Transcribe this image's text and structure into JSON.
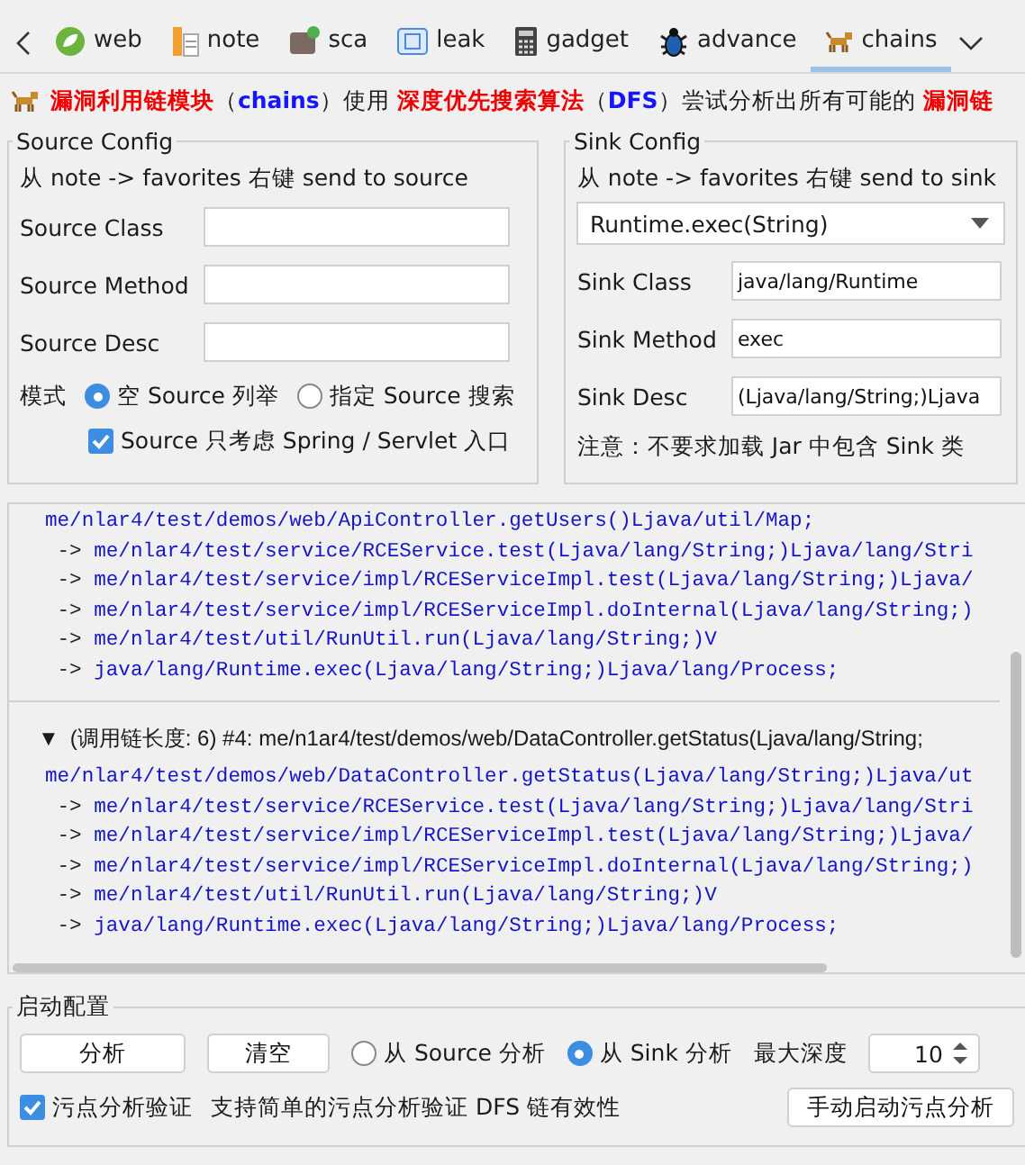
{
  "tabs": [
    {
      "label": "web",
      "selected": false
    },
    {
      "label": "note",
      "selected": false
    },
    {
      "label": "sca",
      "selected": false
    },
    {
      "label": "leak",
      "selected": false
    },
    {
      "label": "gadget",
      "selected": false
    },
    {
      "label": "advance",
      "selected": false
    },
    {
      "label": "chains",
      "selected": true
    }
  ],
  "banner": [
    {
      "text": "漏洞利用链模块",
      "kind": "red"
    },
    {
      "text": "（",
      "kind": "plain"
    },
    {
      "text": "chains",
      "kind": "blue"
    },
    {
      "text": "）使用 ",
      "kind": "plain"
    },
    {
      "text": "深度优先搜索算法",
      "kind": "red"
    },
    {
      "text": "（",
      "kind": "plain"
    },
    {
      "text": "DFS",
      "kind": "blue"
    },
    {
      "text": "）尝试分析出所有可能的 ",
      "kind": "plain"
    },
    {
      "text": "漏洞链",
      "kind": "red"
    }
  ],
  "source_config": {
    "title": "Source Config",
    "hint": "从 note -> favorites 右键 send to source",
    "fields": [
      {
        "label": "Source Class"
      },
      {
        "label": "Source Method"
      },
      {
        "label": "Source Desc"
      }
    ],
    "mode_label": "模式",
    "modes": [
      {
        "label": "空 Source 列举",
        "selected": true
      },
      {
        "label": "指定 Source 搜索",
        "selected": false
      }
    ],
    "entry_only": {
      "label": "Source 只考虑 Spring / Servlet 入口",
      "checked": true
    }
  },
  "sink_config": {
    "title": "Sink Config",
    "hint": "从 note -> favorites 右键 send to sink",
    "preset": "Runtime.exec(String)",
    "fields": [
      {
        "label": "Sink Class",
        "value": "java/lang/Runtime"
      },
      {
        "label": "Sink Method",
        "value": "exec"
      },
      {
        "label": "Sink Desc",
        "value": "(Ljava/lang/String;)Ljava"
      }
    ],
    "note": "注意：不要求加载 Jar 中包含 Sink 类"
  },
  "results": [
    {
      "lines": [
        {
          "call": "me/nlar4/test/demos/web/ApiController.getUsers()Ljava/util/Map;"
        },
        {
          "prefix": "->",
          "call": "me/nlar4/test/service/RCEService.test(Ljava/lang/String;)Ljava/lang/Stri"
        },
        {
          "prefix": "->",
          "call": "me/nlar4/test/service/impl/RCEServiceImpl.test(Ljava/lang/String;)Ljava/"
        },
        {
          "prefix": "->",
          "call": "me/nlar4/test/service/impl/RCEServiceImpl.doInternal(Ljava/lang/String;)"
        },
        {
          "prefix": "->",
          "call": "me/nlar4/test/util/RunUtil.run(Ljava/lang/String;)V"
        },
        {
          "prefix": "->",
          "call": "java/lang/Runtime.exec(Ljava/lang/String;)Ljava/lang/Process;"
        }
      ]
    },
    {
      "toggle": "▼",
      "header": "(调用链长度: 6) #4: me/n1ar4/test/demos/web/DataController.getStatus(Ljava/lang/String;",
      "lines": [
        {
          "call": "me/nlar4/test/demos/web/DataController.getStatus(Ljava/lang/String;)Ljava/ut"
        },
        {
          "prefix": "->",
          "call": "me/nlar4/test/service/RCEService.test(Ljava/lang/String;)Ljava/lang/Stri"
        },
        {
          "prefix": "->",
          "call": "me/nlar4/test/service/impl/RCEServiceImpl.test(Ljava/lang/String;)Ljava/"
        },
        {
          "prefix": "->",
          "call": "me/nlar4/test/service/impl/RCEServiceImpl.doInternal(Ljava/lang/String;)"
        },
        {
          "prefix": "->",
          "call": "me/nlar4/test/util/RunUtil.run(Ljava/lang/String;)V"
        },
        {
          "prefix": "->",
          "call": "java/lang/Runtime.exec(Ljava/lang/String;)Ljava/lang/Process;"
        }
      ]
    }
  ],
  "launch": {
    "title": "启动配置",
    "buttons": [
      "分析",
      "清空"
    ],
    "directions": [
      {
        "label": "从 Source 分析",
        "selected": false
      },
      {
        "label": "从 Sink 分析",
        "selected": true
      }
    ],
    "depth_label": "最大深度",
    "depth": "10",
    "taint_check": {
      "label": "污点分析验证",
      "checked": true
    },
    "taint_note": "支持简单的污点分析验证 DFS 链有效性",
    "manual_button": "手动启动污点分析"
  }
}
